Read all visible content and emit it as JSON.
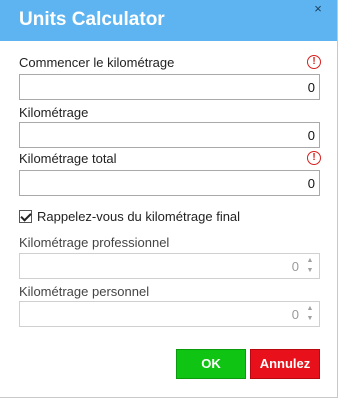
{
  "dialog": {
    "title": "Units Calculator",
    "close_glyph": "×"
  },
  "fields": {
    "start_mileage": {
      "label": "Commencer le kilométrage",
      "value": "0",
      "required": true
    },
    "mileage": {
      "label": "Kilométrage",
      "value": "0"
    },
    "total_mileage": {
      "label": "Kilométrage total",
      "value": "0",
      "required": true
    },
    "business_mileage": {
      "label": "Kilométrage professionnel",
      "value": "0",
      "disabled": true
    },
    "personal_mileage": {
      "label": "Kilométrage personnel",
      "value": "0",
      "disabled": true
    }
  },
  "checkbox": {
    "label": "Rappelez-vous du kilométrage final",
    "checked": true
  },
  "buttons": {
    "ok": "OK",
    "cancel": "Annulez"
  },
  "icons": {
    "warning_glyph": "!",
    "spin_up_glyph": "▲",
    "spin_down_glyph": "▼"
  },
  "colors": {
    "titlebar": "#5eb4f0",
    "ok_button": "#10c414",
    "cancel_button": "#e8101a",
    "warning": "#d62020"
  }
}
